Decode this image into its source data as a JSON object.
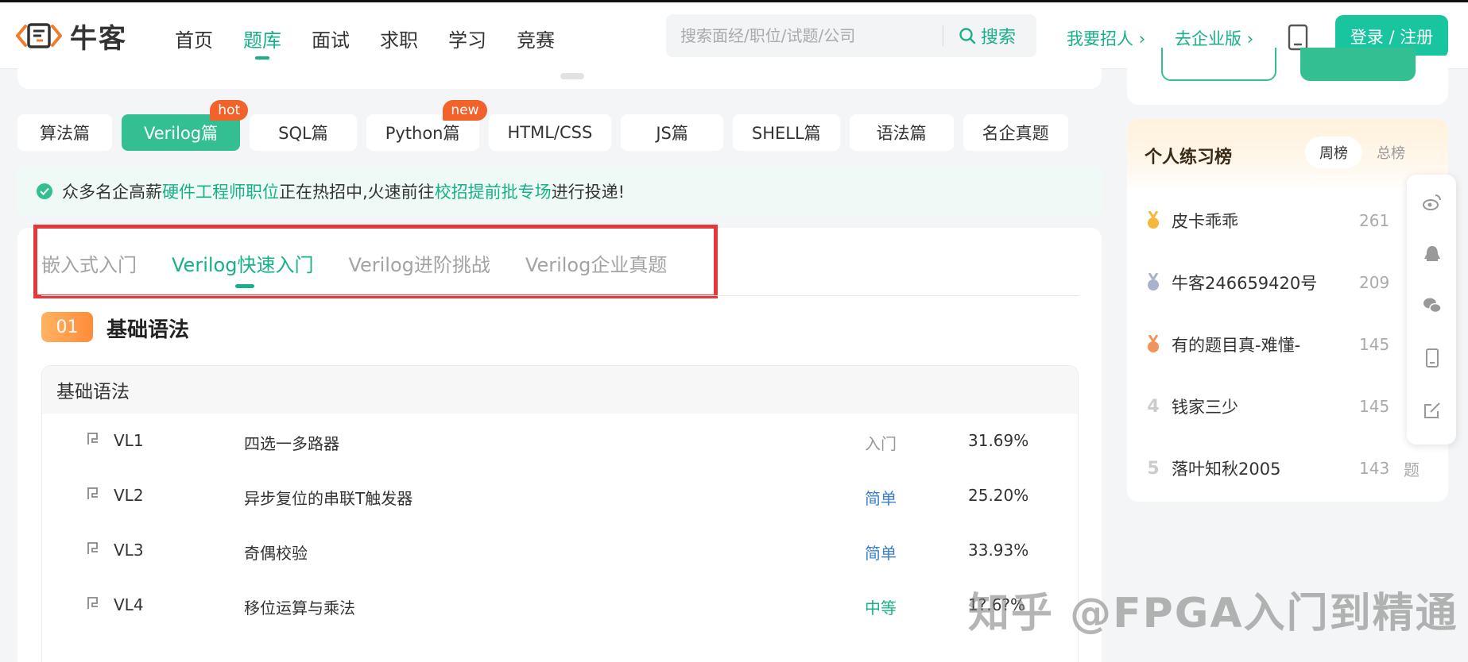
{
  "header": {
    "logo_text": "牛客",
    "nav": [
      "首页",
      "题库",
      "面试",
      "求职",
      "学习",
      "竞赛"
    ],
    "search_placeholder": "搜索面经/职位/试题/公司",
    "search_button": "搜索",
    "recruit_link": "我要招人",
    "enterprise_link": "去企业版",
    "login_button": "登录 / 注册"
  },
  "categories": [
    {
      "label": "算法篇"
    },
    {
      "label": "Verilog篇",
      "badge": "hot"
    },
    {
      "label": "SQL篇"
    },
    {
      "label": "Python篇",
      "badge": "new"
    },
    {
      "label": "HTML/CSS"
    },
    {
      "label": "JS篇"
    },
    {
      "label": "SHELL篇"
    },
    {
      "label": "语法篇"
    },
    {
      "label": "名企真题"
    }
  ],
  "notice": {
    "part1": "众多名企高薪",
    "link1": "硬件工程师职位",
    "part2": "正在热招中,火速前往",
    "link2": "校招提前批专场",
    "part3": "进行投递!"
  },
  "subtabs": [
    "嵌入式入门",
    "Verilog快速入门",
    "Verilog进阶挑战",
    "Verilog企业真题"
  ],
  "section": {
    "number": "01",
    "title": "基础语法",
    "table_title": "基础语法"
  },
  "problems": [
    {
      "id": "VL1",
      "name": "四选一多路器",
      "difficulty": "入门",
      "rate": "31.69%"
    },
    {
      "id": "VL2",
      "name": "异步复位的串联T触发器",
      "difficulty": "简单",
      "rate": "25.20%"
    },
    {
      "id": "VL3",
      "name": "奇偶校验",
      "difficulty": "简单",
      "rate": "33.93%"
    },
    {
      "id": "VL4",
      "name": "移位运算与乘法",
      "difficulty": "中等",
      "rate": "1?.6?%"
    }
  ],
  "ranking": {
    "title": "个人练习榜",
    "tabs": [
      "周榜",
      "总榜"
    ],
    "items": [
      {
        "rank": "1",
        "name": "皮卡乖乖",
        "count": "261"
      },
      {
        "rank": "2",
        "name": "牛客246659420号",
        "count": "209"
      },
      {
        "rank": "3",
        "name": "有的题目真-难懂-",
        "count": "145"
      },
      {
        "rank": "4",
        "name": "钱家三少",
        "count": "145"
      },
      {
        "rank": "5",
        "name": "落叶知秋2005",
        "count": "143"
      }
    ],
    "unit": "题"
  },
  "watermark": "知乎 @FPGA入门到精通",
  "colors": {
    "accent": "#18b08a",
    "accent_button": "#19c59f",
    "badge": "#f2622b",
    "highlight_box": "#e5383b",
    "difficulty_easy": "#3a7fc9",
    "difficulty_medium": "#18b08a",
    "difficulty_intro": "#999999"
  }
}
